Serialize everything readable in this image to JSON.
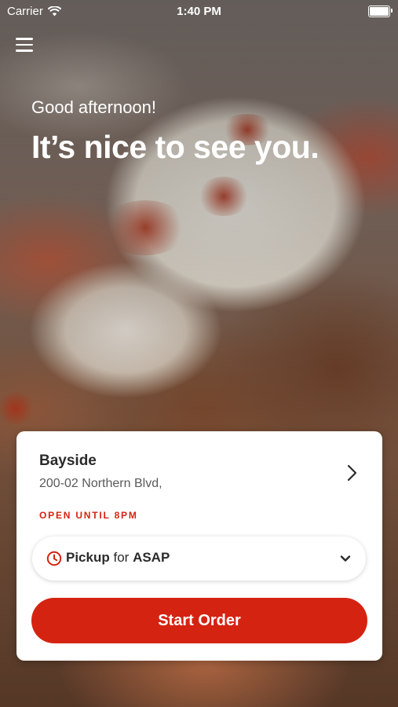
{
  "status_bar": {
    "carrier": "Carrier",
    "time": "1:40 PM"
  },
  "hero": {
    "greeting": "Good afternoon!",
    "headline": "It’s nice to see you."
  },
  "location": {
    "name": "Bayside",
    "address": "200-02 Northern Blvd,",
    "hours": "OPEN UNTIL 8PM"
  },
  "order_mode": {
    "mode": "Pickup",
    "connector": "for",
    "time": "ASAP"
  },
  "actions": {
    "start_order": "Start Order"
  },
  "colors": {
    "accent": "#d52312"
  }
}
